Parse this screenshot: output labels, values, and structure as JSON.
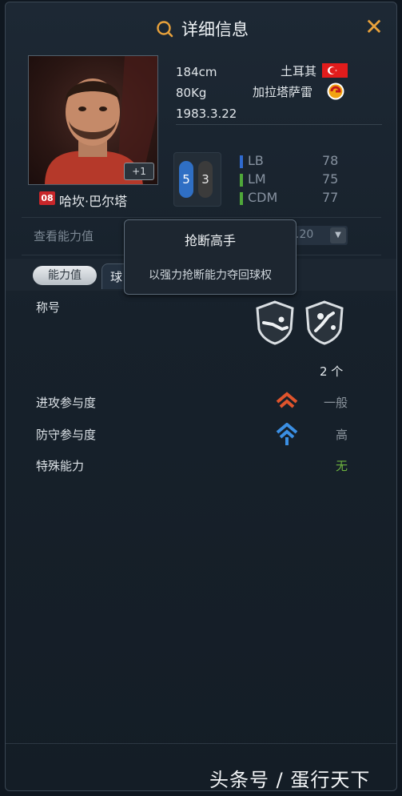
{
  "header": {
    "title": "详细信息",
    "title_icon": "search-icon",
    "close_icon": "close-icon",
    "close_label": "✕"
  },
  "player": {
    "portrait_badge": "+1",
    "number": "08",
    "name": "哈坎·巴尔塔",
    "height": "184cm",
    "weight": "80Kg",
    "birthday": "1983.3.22",
    "nation": "土耳其",
    "club": "加拉塔萨雷",
    "foot_left": "5",
    "foot_right": "3"
  },
  "positions": [
    {
      "label": "LB",
      "value": "78",
      "color": "#2f6ad0"
    },
    {
      "label": "LM",
      "value": "75",
      "color": "#4fa83a"
    },
    {
      "label": "CDM",
      "value": "77",
      "color": "#4fa83a"
    }
  ],
  "ability": {
    "label": "查看能力值",
    "select_value": ".20"
  },
  "tabs": {
    "active": "能力值",
    "second": "球"
  },
  "tooltip": {
    "title": "抢断高手",
    "description": "以强力抢断能力夺回球权"
  },
  "traits": {
    "label": "称号",
    "count": "2 个"
  },
  "stats": [
    {
      "label": "进攻参与度",
      "value": "一般",
      "icon": "arrow-up-medium-icon",
      "color": "#8a939c",
      "icon_color": "#e0542c"
    },
    {
      "label": "防守参与度",
      "value": "高",
      "icon": "arrow-up-high-icon",
      "color": "#8a939c",
      "icon_color": "#3b8fe3"
    },
    {
      "label": "特殊能力",
      "value": "无",
      "icon": "",
      "color": "#6db33f"
    }
  ],
  "watermark": "头条号 / 蛋行天下",
  "colors": {
    "accent": "#e9a23b",
    "panel": "#1d2834"
  }
}
